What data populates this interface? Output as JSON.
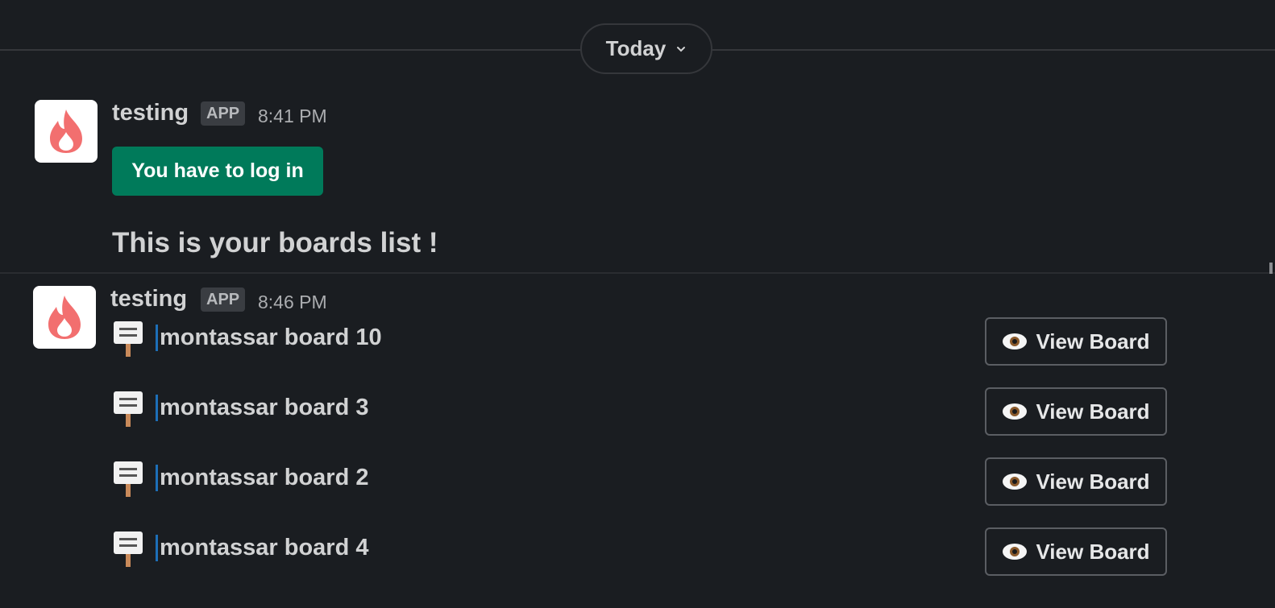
{
  "date_divider": {
    "label": "Today"
  },
  "messages": [
    {
      "sender": "testing",
      "badge": "APP",
      "time": "8:41 PM",
      "button_label": "You have to log in",
      "text": "This is your boards list !"
    },
    {
      "sender": "testing",
      "badge": "APP",
      "time": "8:46 PM",
      "boards": [
        {
          "name": "montassar board 10",
          "action": "View Board"
        },
        {
          "name": "montassar board 3",
          "action": "View Board"
        },
        {
          "name": "montassar board 2",
          "action": "View Board"
        },
        {
          "name": "montassar board 4",
          "action": "View Board"
        }
      ]
    }
  ],
  "icons": {
    "avatar": "fire-icon",
    "board": "placard-icon",
    "view": "eye-icon",
    "date_chevron": "chevron-down-icon"
  },
  "colors": {
    "background": "#1a1d21",
    "login_button": "#007a5a",
    "avatar_fire": "#f26f6f"
  }
}
